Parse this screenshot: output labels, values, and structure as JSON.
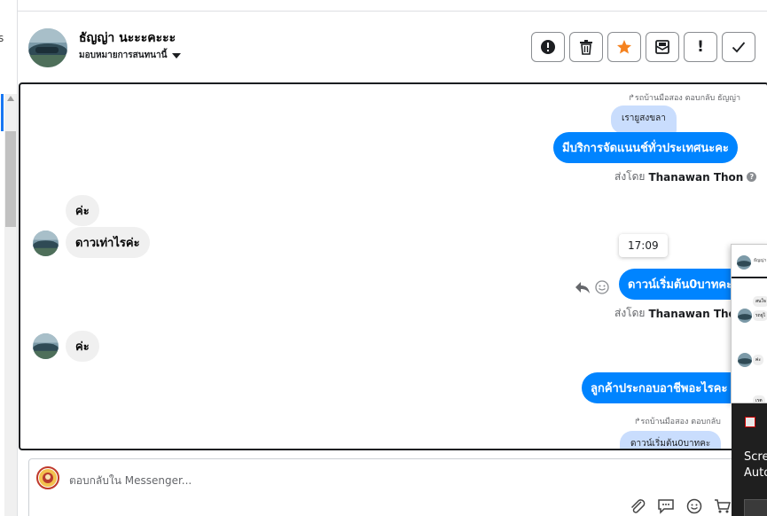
{
  "sidebar": {
    "edge_text": "s"
  },
  "header": {
    "contact_name": "ธัญญ่า นะะะคะะะ",
    "assign_label": "มอบหมายการสนทนานี้"
  },
  "actions": {
    "alert": "!"
  },
  "conversation": {
    "reply_note_1": "↱รถบ้านมือสอง ตอบกลับ ธัญญ่า",
    "quoted_1": "เรายูสงขลา",
    "msg_out_1": "มีบริการจัดแนนช์ทั่วประเทศนะคะ",
    "sent_by_prefix": "ส่งโดย",
    "agent_name": "Thanawan Thon",
    "help_glyph": "?",
    "msg_in_1": "ค่ะ",
    "msg_in_2": "ดาวเท่าไรค่ะ",
    "time_tooltip": "17:09",
    "msg_out_2": "ดาวน์เริ่มต้น0บาทคะ",
    "msg_in_3": "ค่ะ",
    "msg_out_3": "ลูกค้าประกอบอาชีพอะไรคะ",
    "reply_note_2": "↱รถบ้านมือสอง ตอบกลับ ",
    "quoted_2": "ดาวน์เริ่มต้น0บาทคะ"
  },
  "composer": {
    "placeholder": "ตอบกลับใน Messenger..."
  },
  "popup": {
    "head_text": "ธัญญ่า",
    "line1": "สนใจ",
    "line2": "รถยูไ",
    "line3": "ค่ะ",
    "line4": "เรต"
  },
  "dark_panel": {
    "line1": "Scre",
    "line2": "Auto"
  },
  "colors": {
    "messenger_blue": "#0084ff",
    "quoted_blue": "#c9ddfd",
    "star_orange": "#f5821f"
  }
}
